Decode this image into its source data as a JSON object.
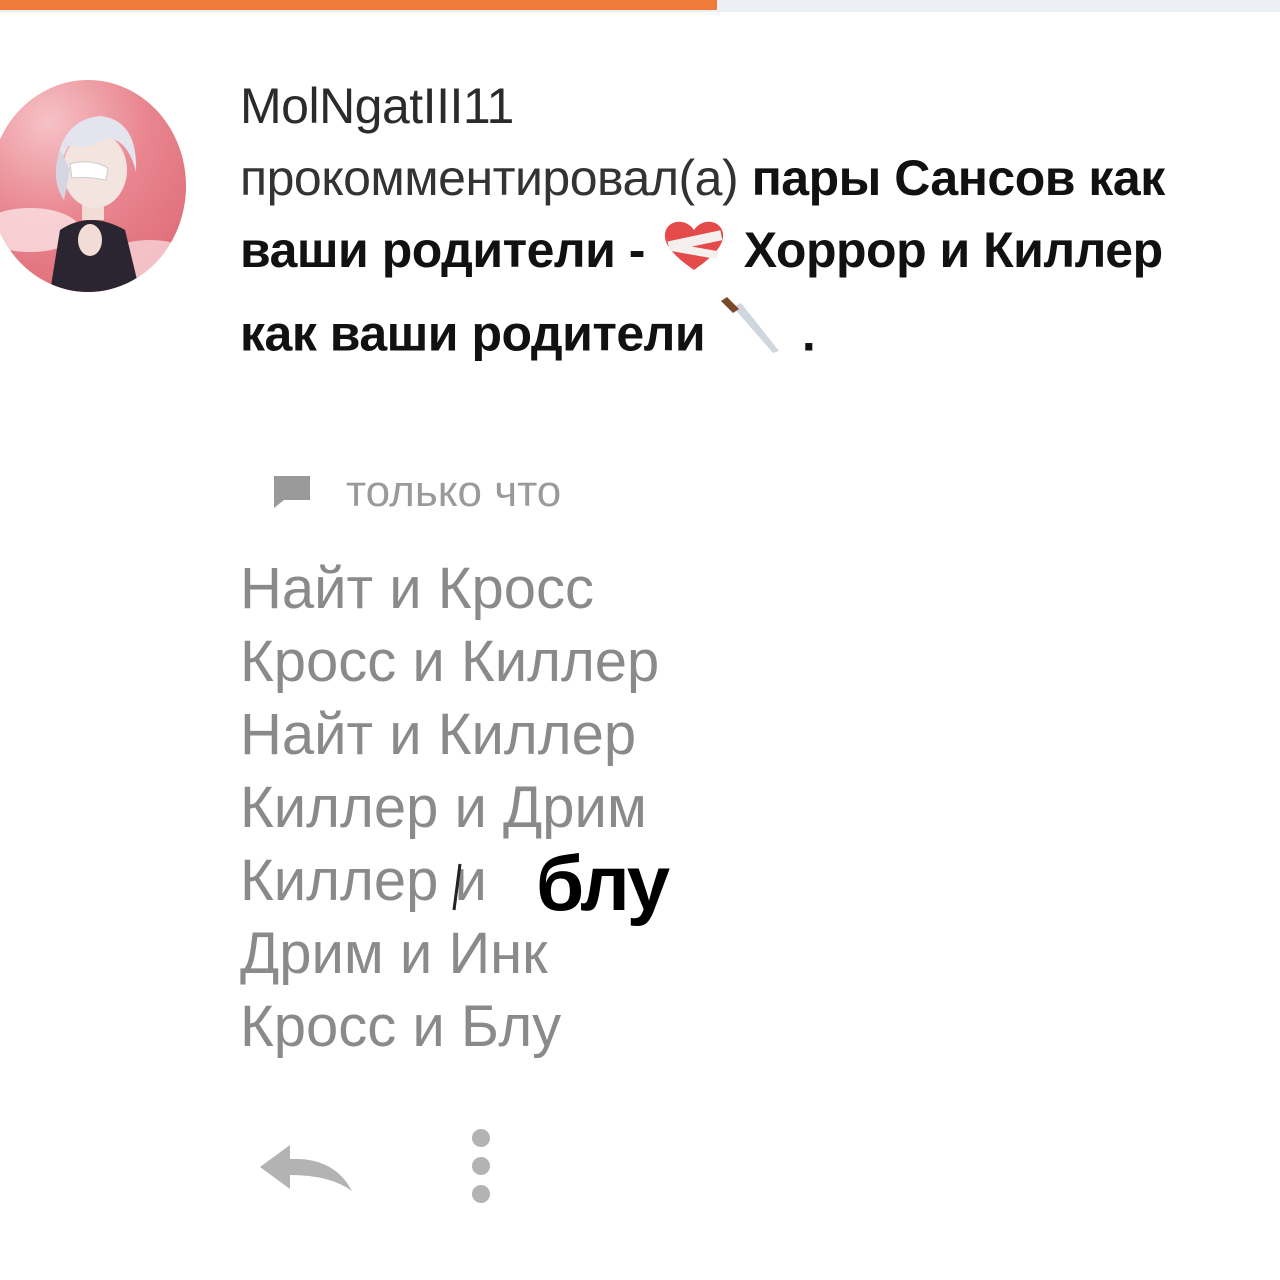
{
  "progress": {
    "value": 0.56,
    "color": "#f07a3a"
  },
  "notification": {
    "username": "MolNgatIII11",
    "action": "прокомментировал(а)",
    "post_title_part1": "пары Сансов как ваши родители - ",
    "post_title_part2": " Хоррор и Киллер как ваши родители ",
    "post_title_end": " .",
    "time": "только что",
    "icons": [
      "bandaged-heart-icon",
      "knife-icon",
      "comment-icon"
    ]
  },
  "comment": {
    "lines": [
      "Найт и Кросс",
      "Кросс и Киллер",
      "Найт и Киллер",
      "Киллер и Дрим",
      "Киллер и",
      "Дрим и Инк",
      "Кросс и Блу"
    ],
    "overlay_word": "блу"
  },
  "actions": {
    "icons": [
      "reply-icon",
      "more-vertical-icon"
    ]
  }
}
